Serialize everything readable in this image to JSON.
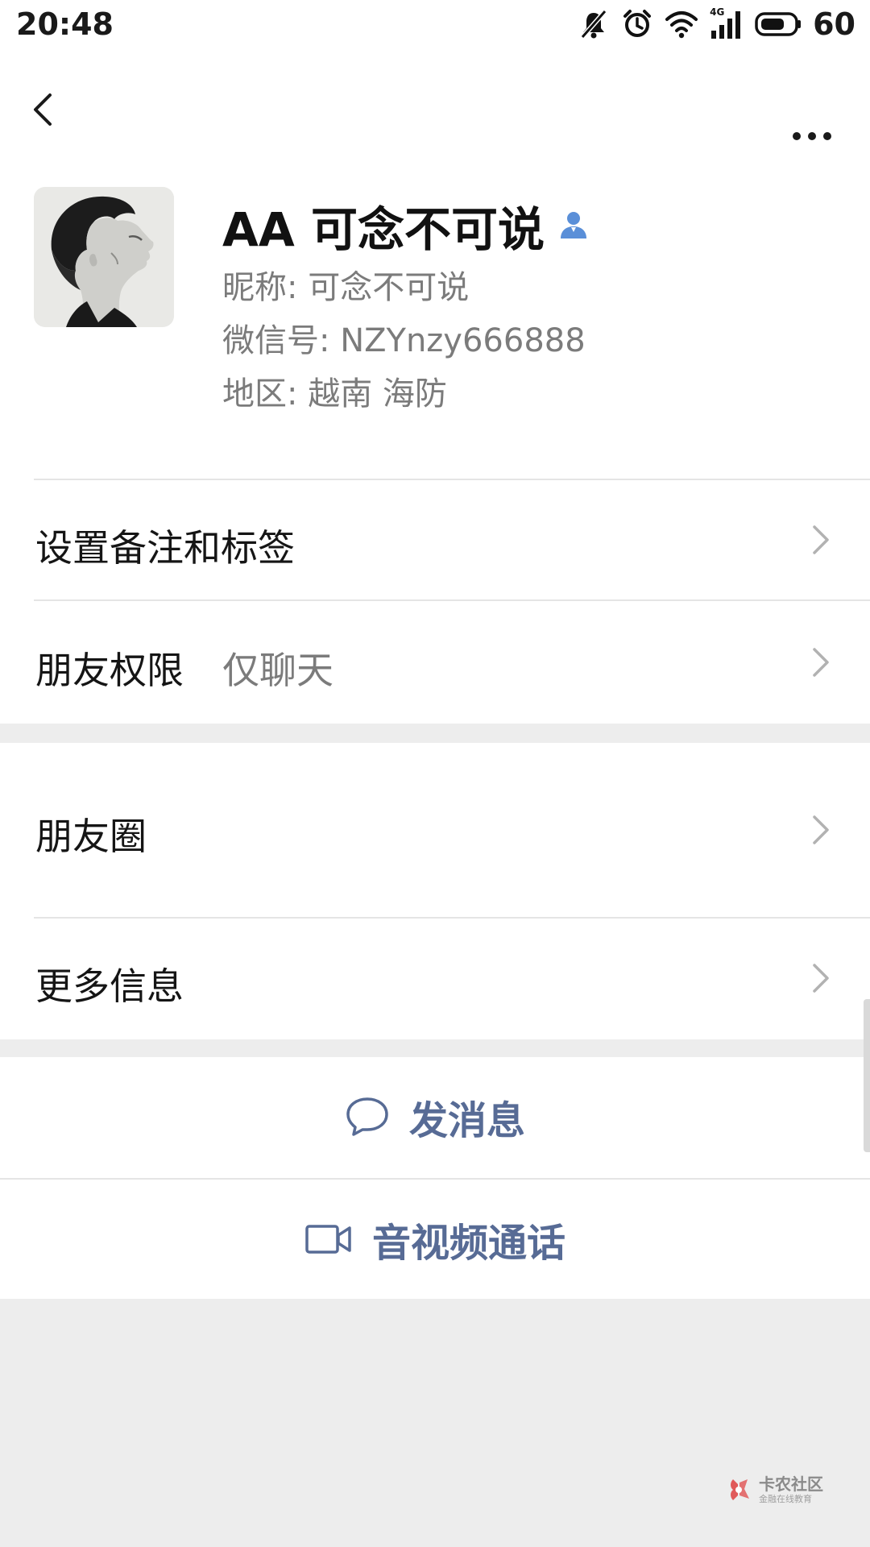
{
  "status_bar": {
    "time": "20:48",
    "battery": "60",
    "network": "4G",
    "icons": [
      "mute-icon",
      "alarm-icon",
      "wifi-icon",
      "cellular-signal-icon",
      "battery-icon"
    ]
  },
  "header": {
    "back_icon": "back-chevron-icon",
    "more_icon": "more-dots-icon"
  },
  "profile": {
    "display_name": "AA 可念不可说",
    "badge_icon": "person-badge-icon",
    "nickname": "昵称:  可念不可说",
    "wechat_id": "微信号:  NZYnzy666888",
    "region": "地区:  越南  海防"
  },
  "settings": {
    "remark_tags_label": "设置备注和标签",
    "permissions_label": "朋友权限",
    "permissions_value": "仅聊天"
  },
  "moments": {
    "moments_label": "朋友圈",
    "more_info_label": "更多信息"
  },
  "actions": {
    "send_message_label": "发消息",
    "video_call_label": "音视频通话"
  },
  "watermark": {
    "name": "卡农社区",
    "tagline": "金融在线教育"
  },
  "colors": {
    "action_text": "#576b95",
    "badge_blue": "#5a8fd8",
    "secondary_text": "#7b7b7b",
    "page_background": "#ededed",
    "card_background": "#ffffff"
  }
}
